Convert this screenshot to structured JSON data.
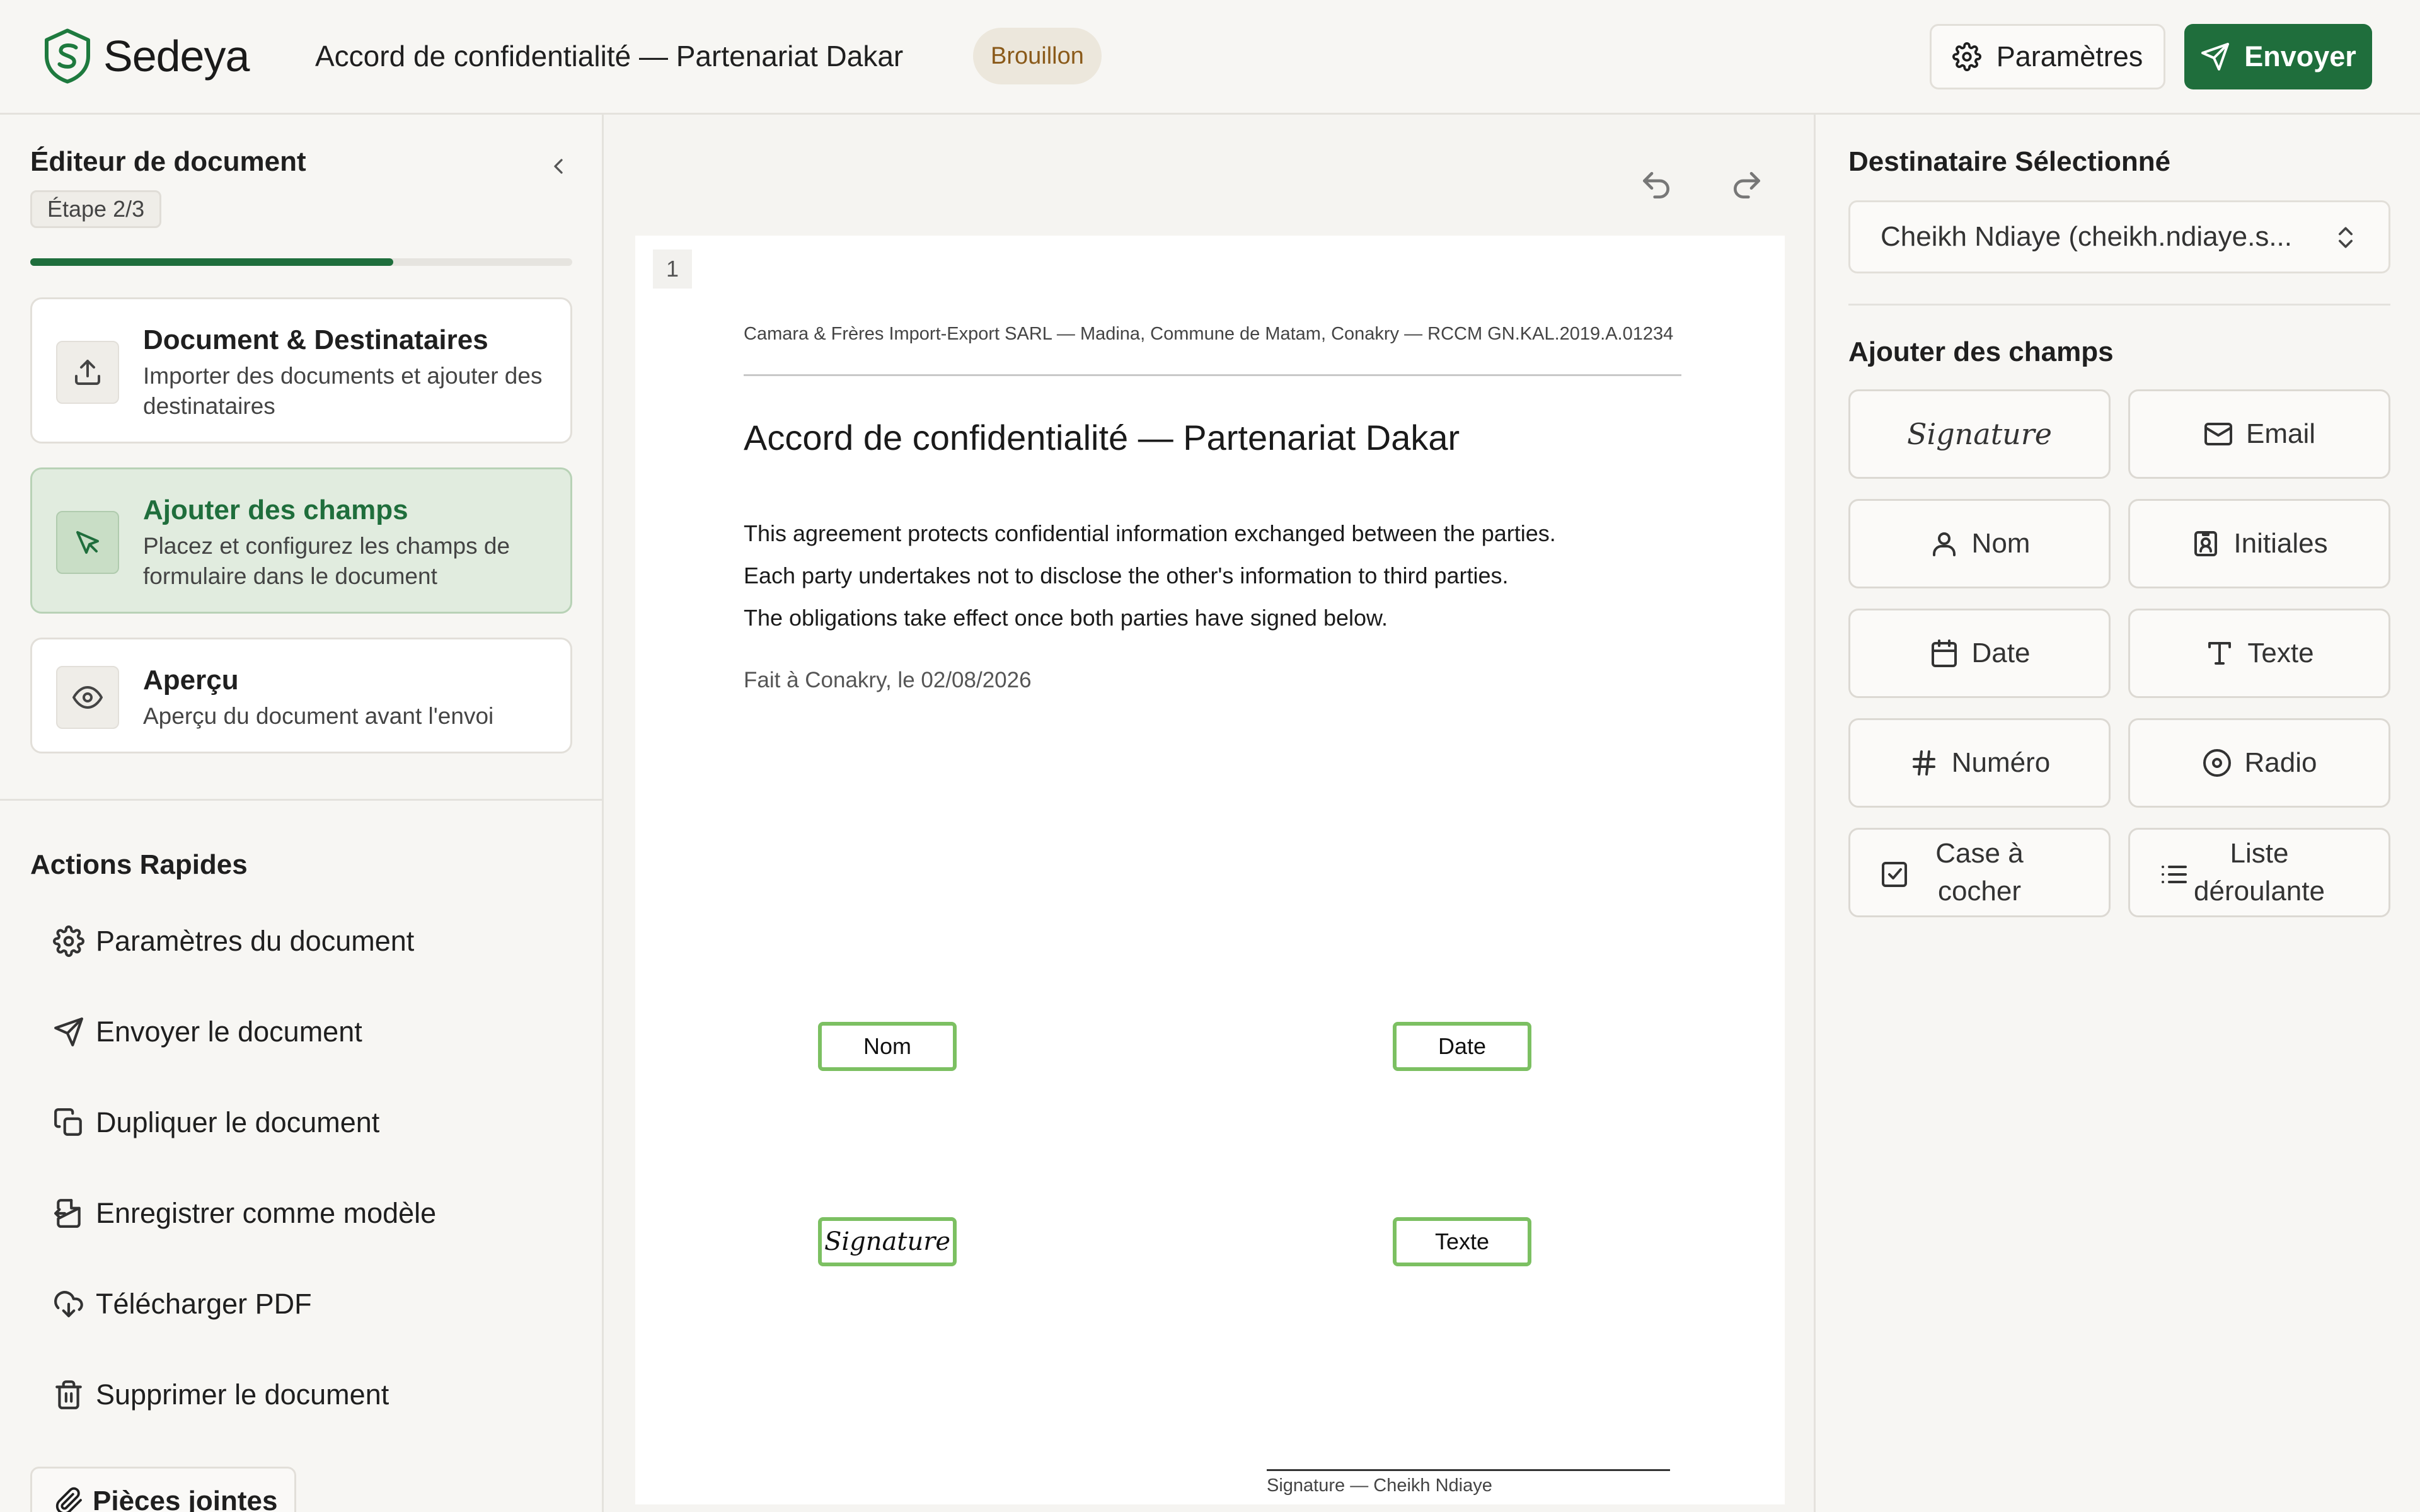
{
  "app": {
    "name": "Sedeya"
  },
  "header": {
    "title": "Accord de confidentialité — Partenariat Dakar",
    "status": "Brouillon",
    "settings_label": "Paramètres",
    "send_label": "Envoyer"
  },
  "sidebar": {
    "title": "Éditeur de document",
    "step_chip": "Étape 2/3",
    "progress": 0.67,
    "steps": [
      {
        "title": "Document & Destinataires",
        "desc": "Importer des documents et ajouter des destinataires",
        "icon": "upload-icon",
        "active": false
      },
      {
        "title": "Ajouter des champs",
        "desc": "Placez et configurez les champs de formulaire dans le document",
        "icon": "cursor-icon",
        "active": true
      },
      {
        "title": "Aperçu",
        "desc": "Aperçu du document avant l'envoi",
        "icon": "eye-icon",
        "active": false
      }
    ],
    "quick_actions_title": "Actions Rapides",
    "quick_actions": [
      {
        "label": "Paramètres du document",
        "icon": "gear-icon"
      },
      {
        "label": "Envoyer le document",
        "icon": "send-icon"
      },
      {
        "label": "Dupliquer le document",
        "icon": "copy-icon"
      },
      {
        "label": "Enregistrer comme modèle",
        "icon": "template-icon"
      },
      {
        "label": "Télécharger PDF",
        "icon": "cloud-download-icon"
      },
      {
        "label": "Supprimer le document",
        "icon": "trash-icon"
      }
    ],
    "attachments_label": "Pièces jointes"
  },
  "document": {
    "page_number": "1",
    "company_line": "Camara & Frères Import-Export SARL — Madina, Commune de Matam, Conakry — RCCM GN.KAL.2019.A.01234",
    "heading": "Accord de confidentialité — Partenariat Dakar",
    "paragraphs": [
      "This agreement protects confidential information exchanged between the parties.",
      "Each party undertakes not to disclose the other's information to third parties.",
      "The obligations take effect once both parties have signed below."
    ],
    "place_date": "Fait à Conakry, le 02/08/2026",
    "fields": [
      {
        "label": "Nom",
        "type": "name"
      },
      {
        "label": "Date",
        "type": "date"
      },
      {
        "label": "Signature",
        "type": "signature"
      },
      {
        "label": "Texte",
        "type": "text"
      }
    ],
    "signature_caption": "Signature — Cheikh Ndiaye"
  },
  "right_panel": {
    "recipient_title": "Destinataire Sélectionné",
    "recipient_value": "Cheikh Ndiaye (cheikh.ndiaye.s...",
    "add_fields_title": "Ajouter des champs",
    "field_buttons": [
      {
        "label": "Signature",
        "icon": ""
      },
      {
        "label": "Email",
        "icon": "mail-icon"
      },
      {
        "label": "Nom",
        "icon": "user-icon"
      },
      {
        "label": "Initiales",
        "icon": "id-badge-icon"
      },
      {
        "label": "Date",
        "icon": "calendar-icon"
      },
      {
        "label": "Texte",
        "icon": "text-icon"
      },
      {
        "label": "Numéro",
        "icon": "hash-icon"
      },
      {
        "label": "Radio",
        "icon": "radio-icon"
      },
      {
        "label": "Case à cocher",
        "icon": "checkbox-icon"
      },
      {
        "label": "Liste déroulante",
        "icon": "list-icon"
      }
    ]
  },
  "colors": {
    "brand": "#1f6e3c",
    "field_border": "#7cc062",
    "draft_badge_bg": "#ece7dc",
    "draft_badge_text": "#8a5a1a"
  }
}
